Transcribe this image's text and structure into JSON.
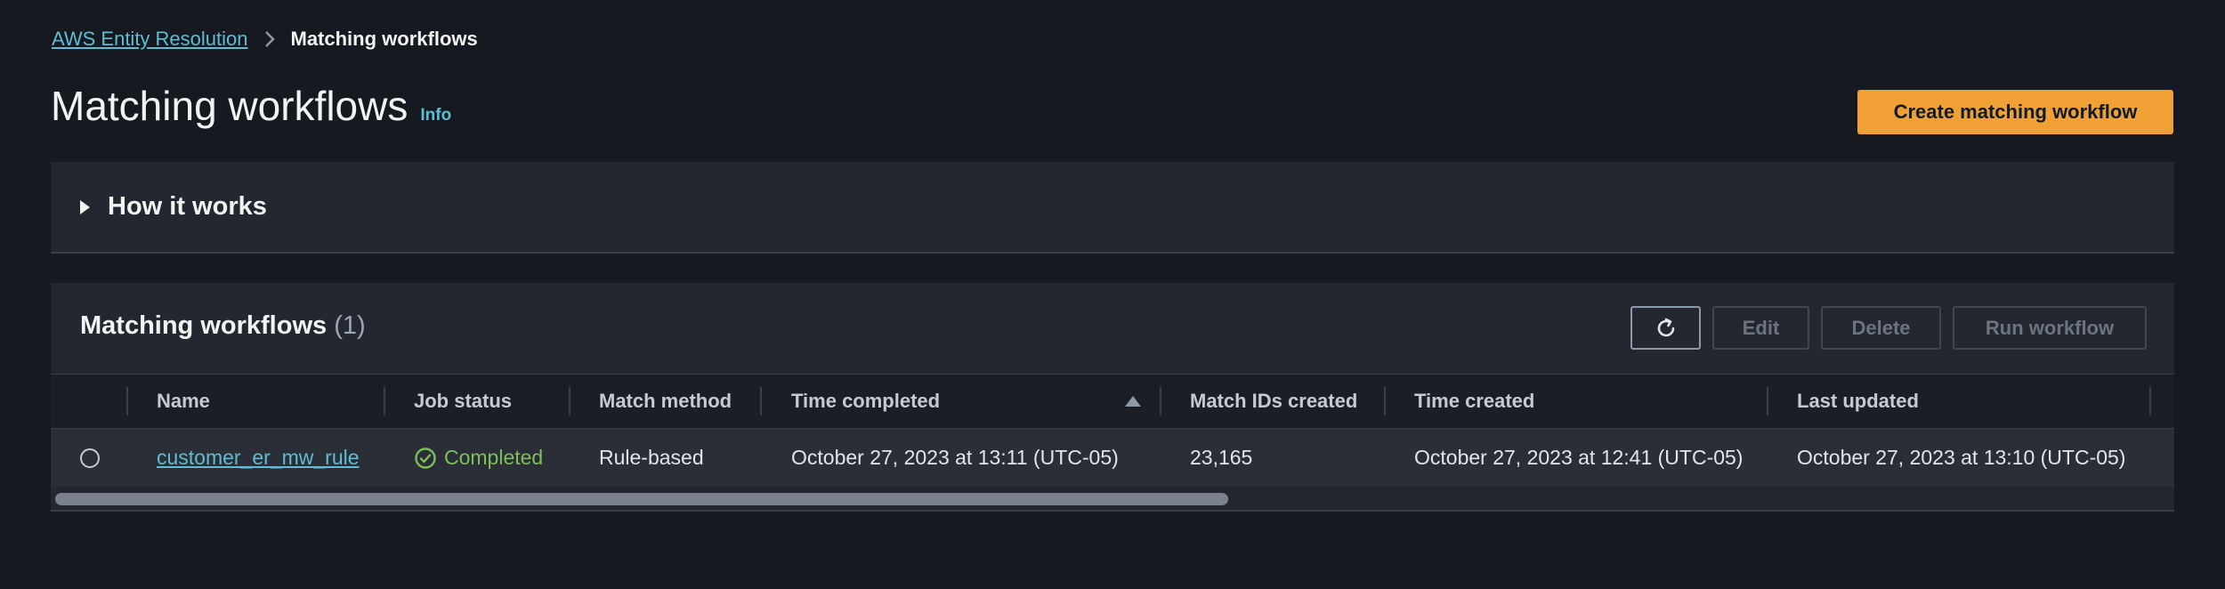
{
  "breadcrumb": {
    "parent": "AWS Entity Resolution",
    "current": "Matching workflows"
  },
  "header": {
    "title": "Matching workflows",
    "info": "Info",
    "create_button": "Create matching workflow"
  },
  "how_it_works": {
    "label": "How it works",
    "expanded": false
  },
  "table": {
    "title": "Matching workflows",
    "count": "(1)",
    "buttons": {
      "refresh_icon": "refresh-icon",
      "edit": "Edit",
      "delete": "Delete",
      "run": "Run workflow"
    },
    "columns": [
      "Name",
      "Job status",
      "Match method",
      "Time completed",
      "Match IDs created",
      "Time created",
      "Last updated"
    ],
    "sort": {
      "column": "Time completed",
      "direction": "ascending"
    },
    "rows": [
      {
        "name": "customer_er_mw_rule",
        "status": "Completed",
        "match_method": "Rule-based",
        "time_completed": "October 27, 2023 at 13:11 (UTC-05)",
        "match_ids_created": "23,165",
        "time_created": "October 27, 2023 at 12:41 (UTC-05)",
        "last_updated": "October 27, 2023 at 13:10 (UTC-05)"
      }
    ]
  },
  "colors": {
    "background": "#16191f",
    "panel": "#232730",
    "link": "#5fbcd3",
    "primary": "#f0a035",
    "success": "#7fbf5a"
  }
}
